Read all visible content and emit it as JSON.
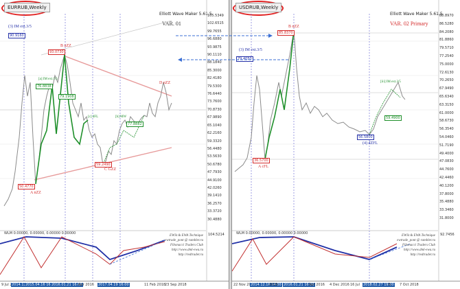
{
  "colors": {
    "accent_red": "#d42a2a",
    "wave_green": "#1e8f2a",
    "channel_pink": "#e79a9a",
    "blue_text": "#2430a8",
    "arrow_blue": "#3b6fd4",
    "price_gray": "#8a8a8a"
  },
  "left": {
    "tab": "EURRUB,Weekly",
    "maker": "Elliott Wave Maker 5.61.5",
    "var": "VAR. 01",
    "prices": [
      "105.5349",
      "102.6515",
      "99.7655",
      "96.6880",
      "93.9875",
      "90.1110",
      "88.1840",
      "85.3000",
      "82.4180",
      "79.5300",
      "76.6440",
      "73.7600",
      "70.8730",
      "67.9890",
      "65.1040",
      "62.2160",
      "59.3320",
      "56.4480",
      "53.5630",
      "50.6780",
      "47.7930",
      "44.9100",
      "42.0260",
      "39.1410",
      "36.2570",
      "33.3720",
      "30.4880"
    ],
    "waves": {
      "im": "(3) IM ext.3/5",
      "b": "B nZZ",
      "d": "D nZZ",
      "c": "C GZZ",
      "a": "A nZZ",
      "im1": "[a] IM ext.1/5",
      "d2": "[c] dFL",
      "d3": "[b] MW",
      "box1": "90.9160",
      "box2": "93.0730",
      "box3": "76.8838",
      "box4": "79.1908",
      "box5": "77.8882",
      "box6": "59.2490",
      "box7": "50.4770"
    },
    "ind": {
      "title": "WLM 0.00000, 0.00000, 0.00000 0.00000",
      "val": "104.5214"
    },
    "dates": [
      "9 Jul 2012",
      "2014.12.16",
      "2015.04.16 16:00",
      "2016.01.21 16:00",
      "Apr 2016",
      "2017.04.19 16:00",
      "11 Feb 2018",
      "23 Sep 2018"
    ]
  },
  "right": {
    "tab": "USDRUB,Weekly",
    "maker": "Elliott Wave Maker 5.61.5",
    "var": "VAR. 02 Primary",
    "prices": [
      "88.8970",
      "86.5280",
      "84.2080",
      "81.8860",
      "79.5710",
      "77.2540",
      "75.0000",
      "72.6130",
      "70.2650",
      "67.9490",
      "65.6340",
      "63.3150",
      "61.0000",
      "58.6730",
      "56.3540",
      "54.0460",
      "51.7190",
      "49.4000",
      "47.0830",
      "44.7600",
      "42.4460",
      "40.1200",
      "37.8000",
      "35.4880",
      "33.3460",
      "31.8000"
    ],
    "waves": {
      "im": "(3) IM ext.3/5",
      "b": "B nZZ",
      "a": "A cFL",
      "d": "(4) dZFL",
      "iii": "[iii] IM ext.3/5",
      "box1": "79.4050",
      "box2": "85.8370",
      "box3": "56.5800",
      "box4": "36.5700",
      "box5": "59.4900"
    },
    "ind": {
      "title": "WLM 0.00000, 0.00000, 0.00000 0.00000",
      "val": "92.7456"
    },
    "dates": [
      "22 Nov 2012",
      "2014.12.16 14:00",
      "2015",
      "2016.01.21 16:00",
      "Apr 2016",
      "4 Dec 2016",
      "16 Jul",
      "2018.02.27 19:00",
      "6",
      "7 Oct 2018"
    ]
  },
  "watermark": [
    "EWSt & EWA Technique",
    "ewtrade_pont @ rambler.ru",
    "Fibonacci Traders Club",
    "http://www.dml-ewa.ru",
    "http://redtrader.ru"
  ]
}
